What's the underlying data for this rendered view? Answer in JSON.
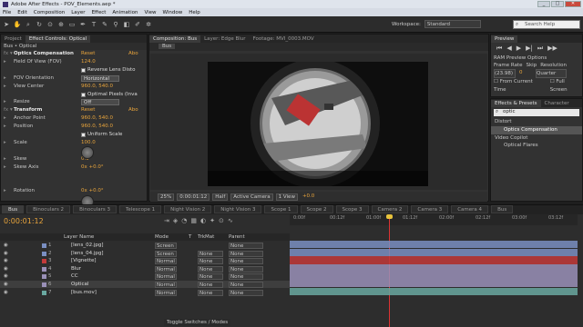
{
  "window": {
    "title": "Adobe After Effects - POV_Elements.aep *",
    "min": "_",
    "max": "□",
    "close": "✕"
  },
  "menu": [
    "File",
    "Edit",
    "Composition",
    "Layer",
    "Effect",
    "Animation",
    "View",
    "Window",
    "Help"
  ],
  "toolbar": {
    "workspace_label": "Workspace:",
    "workspace_value": "Standard",
    "search_placeholder": "Search Help"
  },
  "left_panel": {
    "tabs": [
      "Project",
      "Effect Controls: Optical"
    ],
    "breadcrumb": "Bus • Optical",
    "rows": [
      {
        "name": "Optics Compensation",
        "value": "Reset",
        "extra": "Abo",
        "fx": true,
        "hl": true
      },
      {
        "name": "Field Of View (FOV)",
        "value": "124.0"
      },
      {
        "name": "",
        "check": "Reverse Lens Disto"
      },
      {
        "name": "FOV Orientation",
        "dropdown": "Horizontal"
      },
      {
        "name": "View Center",
        "value": "960.0, 540.0"
      },
      {
        "name": "",
        "check": "Optimal Pixels (Inva"
      },
      {
        "name": "Resize",
        "dropdown": "Off"
      },
      {
        "name": "Transform",
        "value": "Reset",
        "extra": "Abo",
        "fx": true,
        "hl": true
      },
      {
        "name": "Anchor Point",
        "value": "960.0, 540.0"
      },
      {
        "name": "Position",
        "value": "960.0, 540.0"
      },
      {
        "name": "",
        "check": "Uniform Scale"
      },
      {
        "name": "Scale",
        "value": "100.0"
      },
      {
        "name": "",
        "value": ""
      },
      {
        "name": "Skew",
        "value": "0.0"
      },
      {
        "name": "Skew Axis",
        "value": "0x +0.0°"
      },
      {
        "name": "",
        "value": ""
      },
      {
        "name": "",
        "value": ""
      },
      {
        "name": "Rotation",
        "value": "0x +0.0°"
      }
    ]
  },
  "comp_panel": {
    "tabs": [
      "Composition: Bus",
      "Layer: Edge Blur",
      "Footage: MVI_0003.MOV"
    ],
    "comp_tab": "Bus",
    "footer": [
      "25%",
      "0:00:01:12",
      "Half",
      "Active Camera",
      "1 View",
      "+0.0"
    ]
  },
  "preview": {
    "tab": "Preview",
    "ram_options": "RAM Preview Options",
    "frame_rate_label": "Frame Rate",
    "skip_label": "Skip",
    "resolution_label": "Resolution",
    "frame_rate": "(23.98)",
    "skip": "0",
    "resolution": "Quarter",
    "from_current": "From Current Time",
    "full_screen": "Full Screen"
  },
  "effects_presets": {
    "tabs": [
      "Effects & Presets",
      "Character"
    ],
    "search_value": "optic",
    "items": [
      {
        "label": "Distort",
        "level": 0
      },
      {
        "label": "Optics Compensation",
        "level": 1,
        "selected": true
      },
      {
        "label": "Video Copilot",
        "level": 0
      },
      {
        "label": "Optical Flares",
        "level": 1
      }
    ]
  },
  "timeline": {
    "tabs": [
      "Bus",
      "Binoculars 2",
      "Binoculars 3",
      "Telescope 1",
      "Night Vision 2",
      "Night Vision 3",
      "Scope 1",
      "Scope 2",
      "Scope 3",
      "Camera 2",
      "Camera 3",
      "Camera 4",
      "Bus"
    ],
    "timecode": "0:00:01:12",
    "headers": {
      "layer_name": "Layer Name",
      "mode": "Mode",
      "t": "T",
      "trkmat": "TrkMat",
      "parent": "Parent"
    },
    "ruler_ticks": [
      "0:00f",
      "00:12f",
      "01:00f",
      "01:12f",
      "02:00f",
      "02:12f",
      "03:00f",
      "03:12f"
    ],
    "footer": "Toggle Switches / Modes",
    "layers": [
      {
        "num": "1",
        "name": "[lens_02.jpg]",
        "mode": "Screen",
        "trkmat": "",
        "parent": "None",
        "color": "#7a8fc2"
      },
      {
        "num": "2",
        "name": "[lens_04.jpg]",
        "mode": "Screen",
        "trkmat": "None",
        "parent": "None",
        "color": "#7a8fc2"
      },
      {
        "num": "3",
        "name": "[Vignette]",
        "mode": "Normal",
        "trkmat": "None",
        "parent": "None",
        "color": "#c23a3a"
      },
      {
        "num": "4",
        "name": "Blur",
        "mode": "Normal",
        "trkmat": "None",
        "parent": "None",
        "color": "#9a90b8"
      },
      {
        "num": "5",
        "name": "CC",
        "mode": "Normal",
        "trkmat": "None",
        "parent": "None",
        "color": "#9a90b8"
      },
      {
        "num": "6",
        "name": "Optical",
        "mode": "Normal",
        "trkmat": "None",
        "parent": "None",
        "color": "#9a90b8"
      },
      {
        "num": "7",
        "name": "[bus.mov]",
        "mode": "Normal",
        "trkmat": "None",
        "parent": "None",
        "color": "#6aa8a0"
      }
    ]
  }
}
